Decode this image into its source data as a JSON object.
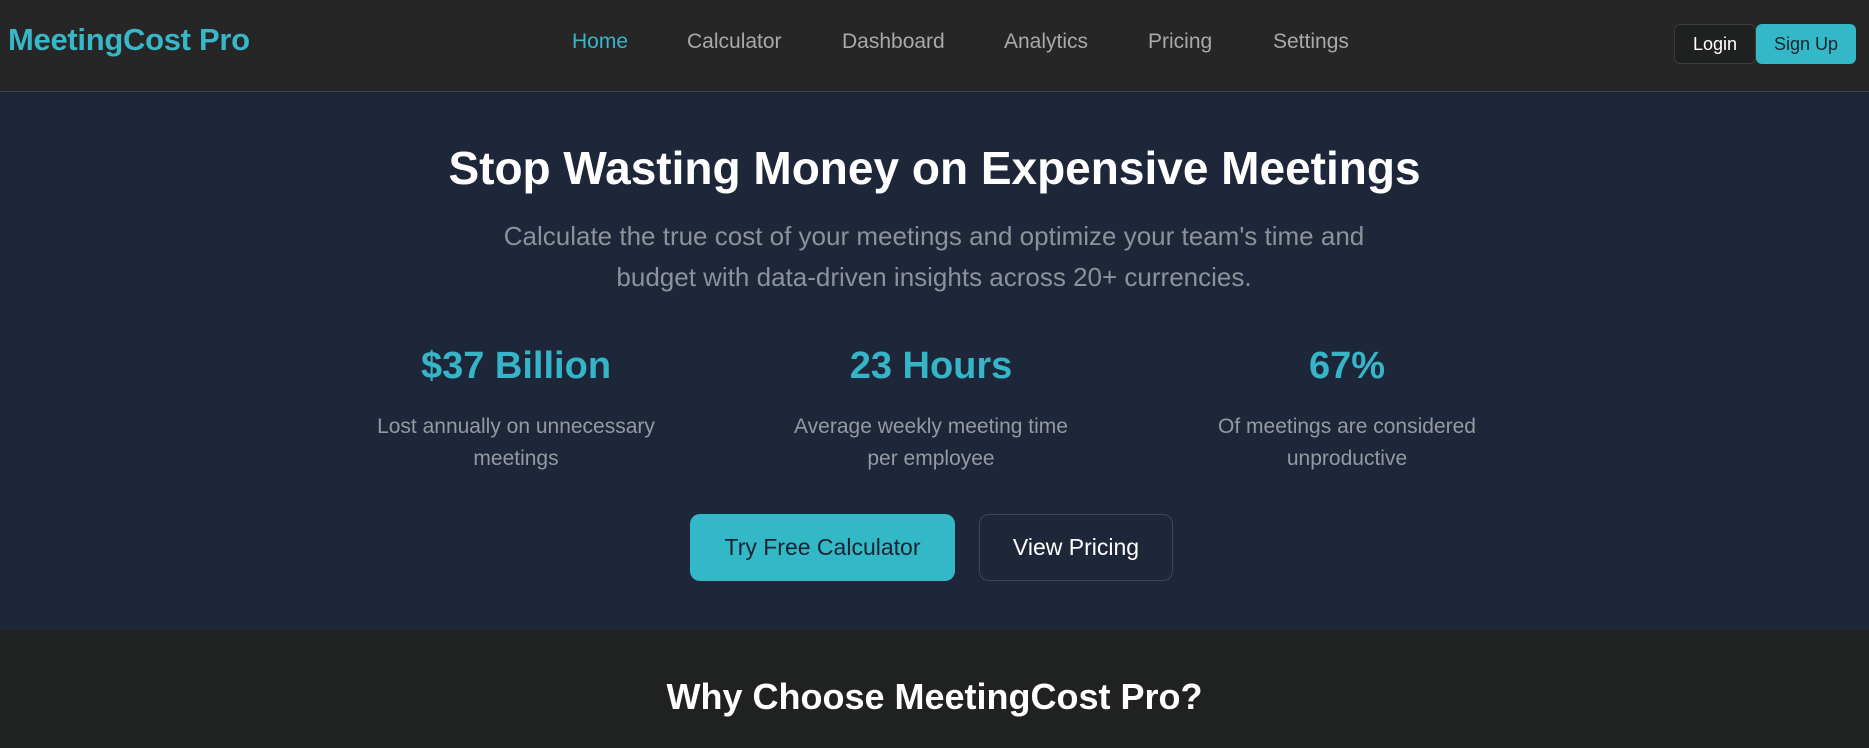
{
  "brand": "MeetingCost Pro",
  "nav": {
    "items": [
      {
        "label": "Home"
      },
      {
        "label": "Calculator"
      },
      {
        "label": "Dashboard"
      },
      {
        "label": "Analytics"
      },
      {
        "label": "Pricing"
      },
      {
        "label": "Settings"
      }
    ],
    "active": "Home",
    "login_label": "Login",
    "signup_label": "Sign Up"
  },
  "hero": {
    "title": "Stop Wasting Money on Expensive Meetings",
    "subtitle": "Calculate the true cost of your meetings and optimize your team's time and budget with data-driven insights across 20+ currencies.",
    "stats": [
      {
        "value": "$37 Billion",
        "label": "Lost annually on unnecessary meetings"
      },
      {
        "value": "23 Hours",
        "label": "Average weekly meeting time per employee"
      },
      {
        "value": "67%",
        "label": "Of meetings are considered unproductive"
      }
    ],
    "primary_cta": "Try Free Calculator",
    "secondary_cta": "View Pricing"
  },
  "why_section": {
    "title": "Why Choose MeetingCost Pro?"
  },
  "colors": {
    "accent": "#33b8c7",
    "nav_bg": "#252625",
    "hero_bg": "#1e2639",
    "page_bg": "#202221"
  }
}
